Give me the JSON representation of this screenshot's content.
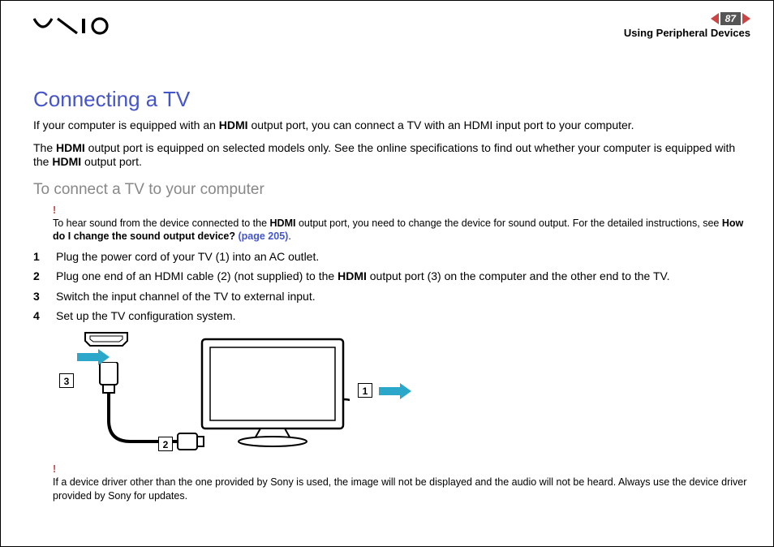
{
  "header": {
    "page_number": "87",
    "section": "Using Peripheral Devices"
  },
  "title": "Connecting a TV",
  "para1_pre": "If your computer is equipped with an ",
  "para1_b1": "HDMI",
  "para1_post": " output port, you can connect a TV with an HDMI input port to your computer.",
  "para2_pre": "The ",
  "para2_b1": "HDMI",
  "para2_mid": " output port is equipped on selected models only. See the online specifications to find out whether your computer is equipped with the ",
  "para2_b2": "HDMI",
  "para2_post": " output port.",
  "subhead": "To connect a TV to your computer",
  "note1": {
    "bang": "!",
    "pre": "To hear sound from the device connected to the ",
    "b1": "HDMI",
    "mid": " output port, you need to change the device for sound output. For the detailed instructions, see ",
    "b2": "How do I change the sound output device? ",
    "link": "(page 205)",
    "post": "."
  },
  "steps": [
    {
      "text_pre": "Plug the power cord of your TV (1) into an AC outlet.",
      "b": "",
      "text_post": ""
    },
    {
      "text_pre": "Plug one end of an HDMI cable (2) (not supplied) to the ",
      "b": "HDMI",
      "text_post": " output port (3) on the computer and the other end to the TV."
    },
    {
      "text_pre": "Switch the input channel of the TV to external input.",
      "b": "",
      "text_post": ""
    },
    {
      "text_pre": "Set up the TV configuration system.",
      "b": "",
      "text_post": ""
    }
  ],
  "diagram": {
    "callout1": "1",
    "callout2": "2",
    "callout3": "3"
  },
  "note2": {
    "bang": "!",
    "text": "If a device driver other than the one provided by Sony is used, the image will not be displayed and the audio will not be heard. Always use the device driver provided by Sony for updates."
  }
}
